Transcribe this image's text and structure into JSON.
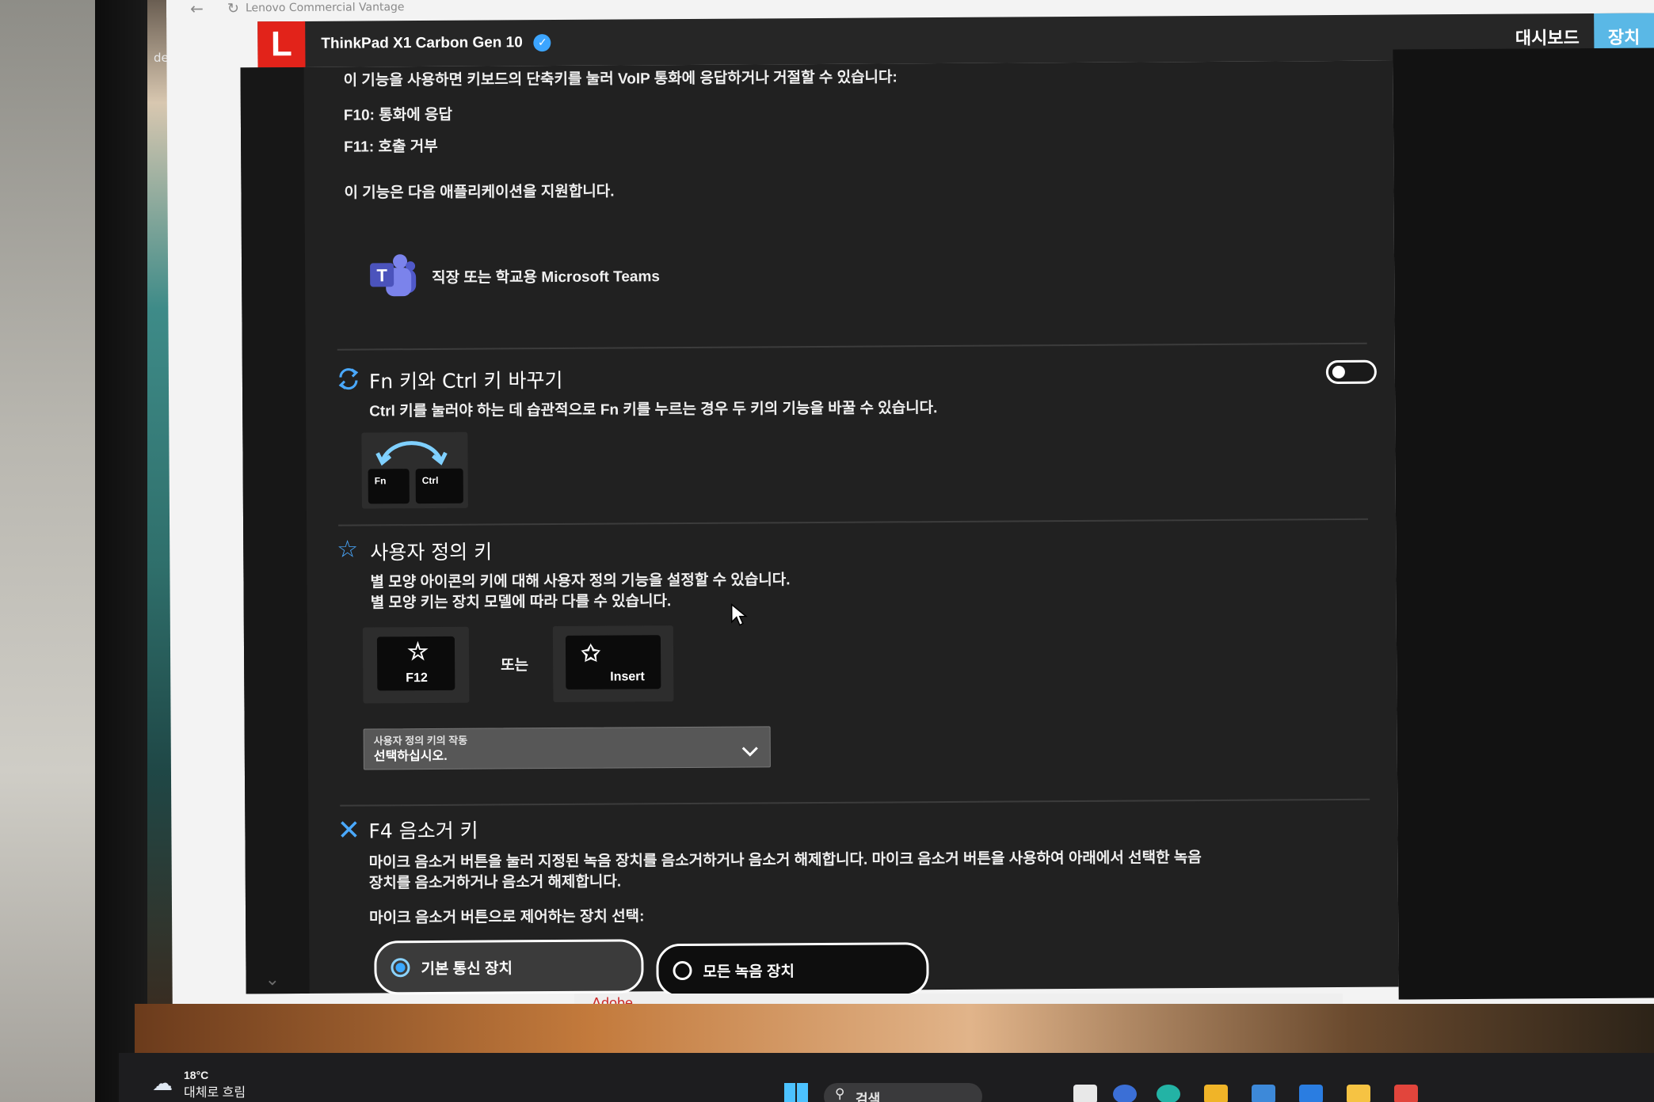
{
  "window": {
    "title": "Lenovo Commercial Vantage",
    "back_icon": "arrow-left-icon",
    "refresh_icon": "refresh-icon"
  },
  "desktop": {
    "icon_label": "desk",
    "weather_temp": "18°C",
    "weather_desc": "대체로 흐림",
    "search_label": "검색",
    "adobe_text": "Adobe"
  },
  "header": {
    "device_name": "ThinkPad X1 Carbon Gen 10",
    "nav": [
      "대시보드",
      "장치"
    ]
  },
  "voip": {
    "description": "이 기능을 사용하면 키보드의 단축키를 눌러 VoIP 통화에 응답하거나 거절할 수 있습니다:",
    "f10": "F10: 통화에 응답",
    "f11": "F11: 호출 거부",
    "supports": "이 기능은 다음 애플리케이션을 지원합니다.",
    "app_name": "직장 또는 학교용 Microsoft Teams"
  },
  "fn_ctrl": {
    "title": "Fn 키와 Ctrl 키 바꾸기",
    "description": "Ctrl 키를 눌러야 하는 데 습관적으로 Fn 키를 누르는 경우 두 키의 기능을 바꿀 수 있습니다.",
    "key_fn": "Fn",
    "key_ctrl": "Ctrl",
    "toggle_on": false
  },
  "custom_key": {
    "title": "사용자 정의 키",
    "line1": "별 모양 아이콘의 키에 대해 사용자 정의 기능을 설정할 수 있습니다.",
    "line2": "별 모양 키는 장치 모델에 따라 다를 수 있습니다.",
    "key_f12": "F12",
    "or": "또는",
    "key_insert": "Insert",
    "dropdown_label": "사용자 정의 키의 작동",
    "dropdown_value": "선택하십시오."
  },
  "f4_mute": {
    "title": "F4 음소거 키",
    "line1": "마이크 음소거 버튼을 눌러 지정된 녹음 장치를 음소거하거나 음소거 해제합니다. 마이크 음소거 버튼을 사용하여 아래에서 선택한 녹음",
    "line2": "장치를 음소거하거나 음소거 해제합니다.",
    "select_label": "마이크 음소거 버튼으로 제어하는 장치 선택:",
    "options": [
      "기본 통신 장치",
      "모든 녹음 장치"
    ],
    "selected_index": 0
  },
  "colors": {
    "accent": "#5ab8e6",
    "brand_red": "#e2231a",
    "panel": "#212121",
    "icon_blue": "#4aa9ff"
  }
}
